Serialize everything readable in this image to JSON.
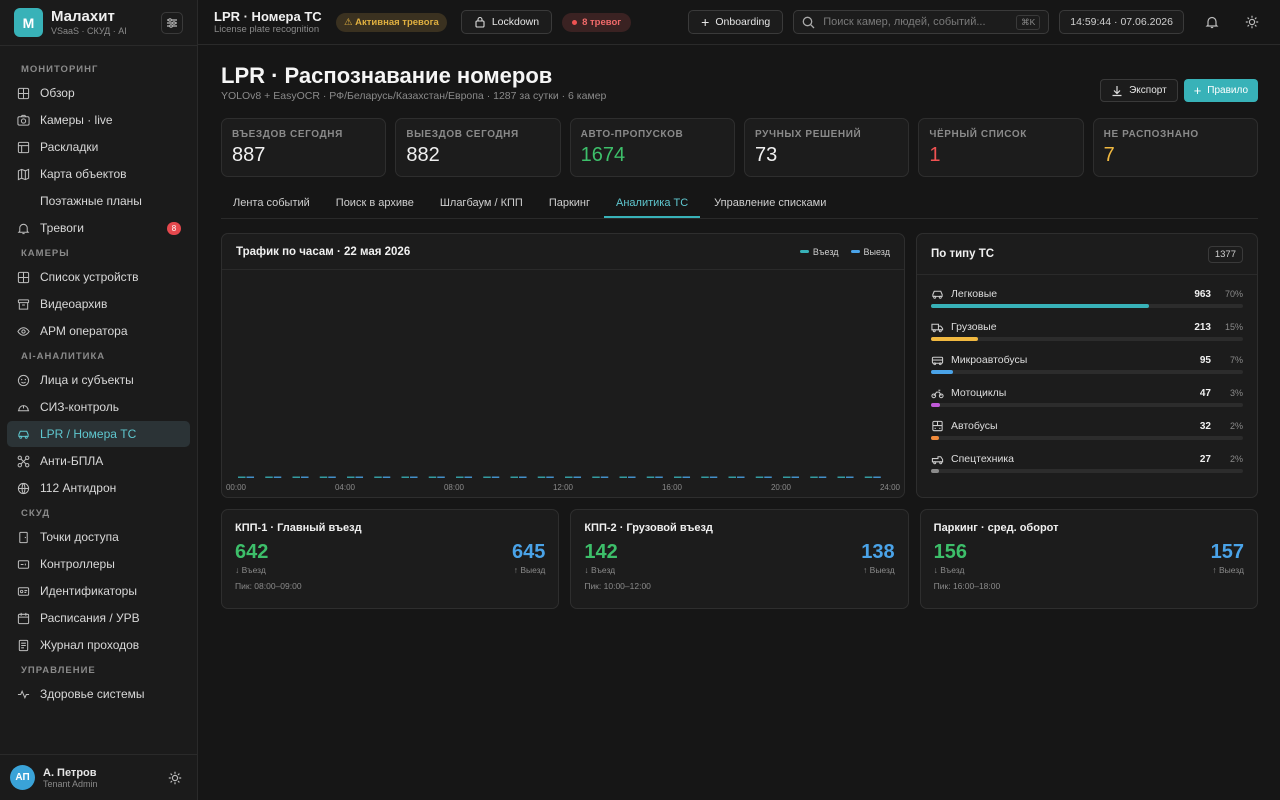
{
  "brand": {
    "logo_letter": "M",
    "name": "Малахит",
    "sub": "VSaaS · СКУД · AI"
  },
  "nav": {
    "sections": [
      {
        "label": "МОНИТОРИНГ",
        "items": [
          {
            "label": "Обзор",
            "icon": "grid-icon"
          },
          {
            "label": "Камеры · live",
            "icon": "camera-icon"
          },
          {
            "label": "Раскладки",
            "icon": "layout-icon"
          },
          {
            "label": "Карта объектов",
            "icon": "map-icon"
          },
          {
            "label": "Поэтажные планы",
            "icon": "",
            "sub": true
          },
          {
            "label": "Тревоги",
            "icon": "bell-icon",
            "badge": "8"
          }
        ]
      },
      {
        "label": "КАМЕРЫ",
        "items": [
          {
            "label": "Список устройств",
            "icon": "grid-icon"
          },
          {
            "label": "Видеоархив",
            "icon": "archive-icon"
          },
          {
            "label": "АРМ оператора",
            "icon": "eye-icon"
          }
        ]
      },
      {
        "label": "AI-АНАЛИТИКА",
        "items": [
          {
            "label": "Лица и субъекты",
            "icon": "face-icon"
          },
          {
            "label": "СИЗ-контроль",
            "icon": "helmet-icon"
          },
          {
            "label": "LPR / Номера ТС",
            "icon": "car-icon",
            "active": true
          },
          {
            "label": "Анти-БПЛА",
            "icon": "drone-icon"
          },
          {
            "label": "112 Антидрон",
            "icon": "globe-icon"
          }
        ]
      },
      {
        "label": "СКУД",
        "items": [
          {
            "label": "Точки доступа",
            "icon": "door-icon"
          },
          {
            "label": "Контроллеры",
            "icon": "controller-icon"
          },
          {
            "label": "Идентификаторы",
            "icon": "id-card-icon"
          },
          {
            "label": "Расписания / УРВ",
            "icon": "calendar-icon"
          },
          {
            "label": "Журнал проходов",
            "icon": "journal-icon"
          }
        ]
      },
      {
        "label": "УПРАВЛЕНИЕ",
        "items": [
          {
            "label": "Здоровье системы",
            "icon": "pulse-icon"
          }
        ]
      }
    ]
  },
  "user": {
    "initials": "АП",
    "name": "А. Петров",
    "role": "Tenant Admin"
  },
  "topbar": {
    "title": "LPR · Номера ТС",
    "subtitle": "License plate recognition",
    "alarm_pill": "⚠ Активная тревога",
    "lockdown_label": "Lockdown",
    "alerts_pill": "8 тревог",
    "onboarding_label": "Onboarding",
    "search_placeholder": "Поиск камер, людей, событий...",
    "search_kbd": "⌘K",
    "clock": "14:59:44 · 07.06.2026"
  },
  "page": {
    "title": "LPR · Распознавание номеров",
    "subtitle": "YOLOv8 + EasyOCR · РФ/Беларусь/Казахстан/Европа · 1287 за сутки · 6 камер",
    "export_label": "Экспорт",
    "rule_label": "Правило"
  },
  "stats": [
    {
      "label": "ВЪЕЗДОВ СЕГОДНЯ",
      "value": "887",
      "color": "#f0f0f0"
    },
    {
      "label": "ВЫЕЗДОВ СЕГОДНЯ",
      "value": "882",
      "color": "#f0f0f0"
    },
    {
      "label": "АВТО-ПРОПУСКОВ",
      "value": "1674",
      "color": "#3dbf6a"
    },
    {
      "label": "РУЧНЫХ РЕШЕНИЙ",
      "value": "73",
      "color": "#f0f0f0"
    },
    {
      "label": "ЧЁРНЫЙ СПИСОК",
      "value": "1",
      "color": "#f05252"
    },
    {
      "label": "НЕ РАСПОЗНАНО",
      "value": "7",
      "color": "#f0b840"
    }
  ],
  "tabs": [
    "Лента событий",
    "Поиск в архиве",
    "Шлагбаум / КПП",
    "Паркинг",
    "Аналитика ТС",
    "Управление списками"
  ],
  "active_tab": 4,
  "chart_data": {
    "type": "bar",
    "title": "Трафик по часам · 22 мая 2026",
    "x_ticks": [
      "00:00",
      "04:00",
      "08:00",
      "12:00",
      "16:00",
      "20:00",
      "24:00"
    ],
    "categories": [
      "00",
      "01",
      "02",
      "03",
      "04",
      "05",
      "06",
      "07",
      "08",
      "09",
      "10",
      "11",
      "12",
      "13",
      "14",
      "15",
      "16",
      "17",
      "18",
      "19",
      "20",
      "21",
      "22",
      "23"
    ],
    "series": [
      {
        "name": "Въезд",
        "color": "#38b2b8",
        "values": [
          0,
          0,
          0,
          0,
          0,
          0,
          0,
          0,
          0,
          0,
          0,
          0,
          0,
          0,
          0,
          0,
          0,
          0,
          0,
          0,
          0,
          0,
          0,
          0
        ]
      },
      {
        "name": "Выезд",
        "color": "#4aa3e8",
        "values": [
          0,
          0,
          0,
          0,
          0,
          0,
          0,
          0,
          0,
          0,
          0,
          0,
          0,
          0,
          0,
          0,
          0,
          0,
          0,
          0,
          0,
          0,
          0,
          0
        ]
      }
    ],
    "legend": "top-right"
  },
  "types": {
    "title": "По типу ТС",
    "total": "1377",
    "items": [
      {
        "name": "Легковые",
        "count": "963",
        "pct": "70%",
        "fraction": 0.7,
        "color": "#38b2b8",
        "icon": "car-icon"
      },
      {
        "name": "Грузовые",
        "count": "213",
        "pct": "15%",
        "fraction": 0.15,
        "color": "#f0b840",
        "icon": "truck-icon"
      },
      {
        "name": "Микроавтобусы",
        "count": "95",
        "pct": "7%",
        "fraction": 0.07,
        "color": "#4aa3e8",
        "icon": "minibus-icon"
      },
      {
        "name": "Мотоциклы",
        "count": "47",
        "pct": "3%",
        "fraction": 0.03,
        "color": "#c05ad8",
        "icon": "motorcycle-icon"
      },
      {
        "name": "Автобусы",
        "count": "32",
        "pct": "2%",
        "fraction": 0.02,
        "color": "#f08a3a",
        "icon": "bus-icon"
      },
      {
        "name": "Спецтехника",
        "count": "27",
        "pct": "2%",
        "fraction": 0.02,
        "color": "#8a8a8a",
        "icon": "special-vehicle-icon"
      }
    ]
  },
  "checkpoints": [
    {
      "title": "КПП-1 · Главный въезд",
      "in": "642",
      "in_label": "↓ Въезд",
      "out": "645",
      "out_label": "↑ Выезд",
      "peak": "Пик: 08:00–09:00"
    },
    {
      "title": "КПП-2 · Грузовой въезд",
      "in": "142",
      "in_label": "↓ Въезд",
      "out": "138",
      "out_label": "↑ Выезд",
      "peak": "Пик: 10:00–12:00"
    },
    {
      "title": "Паркинг · сред. оборот",
      "in": "156",
      "in_label": "↓ Въезд",
      "out": "157",
      "out_label": "↑ Выезд",
      "peak": "Пик: 16:00–18:00"
    }
  ]
}
